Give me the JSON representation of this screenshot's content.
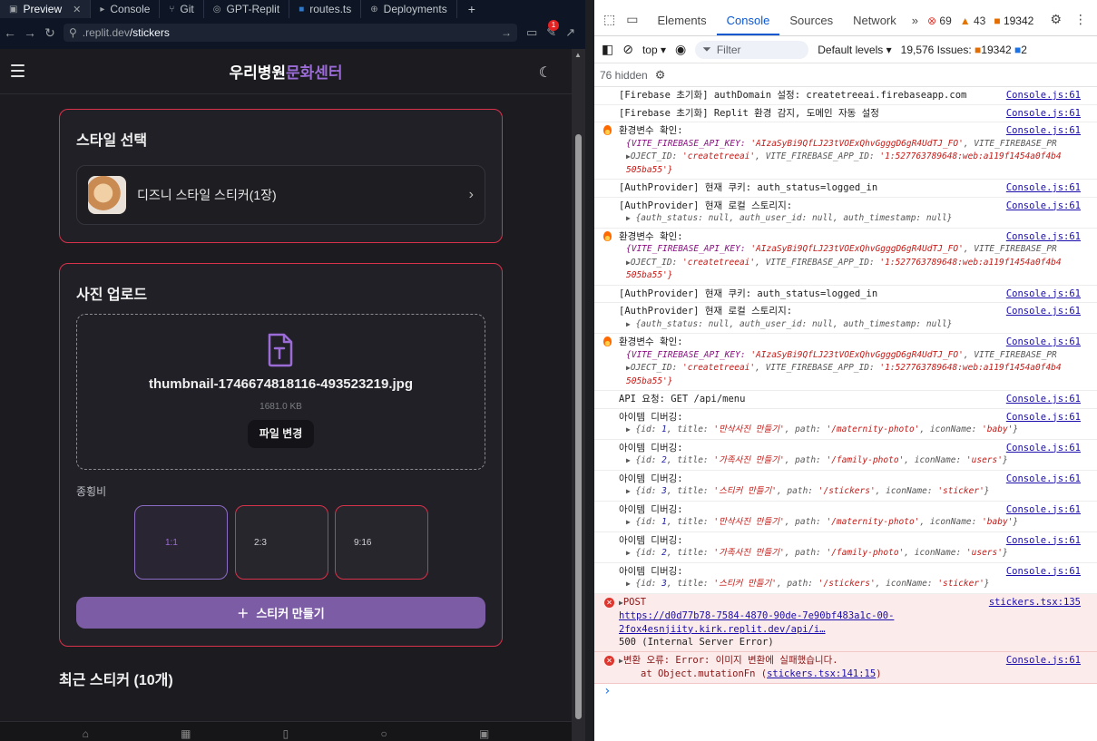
{
  "browser": {
    "tabs": [
      {
        "label": "Preview",
        "icon": "preview-icon"
      },
      {
        "label": "Console",
        "icon": "console-icon"
      },
      {
        "label": "Git",
        "icon": "git-icon"
      },
      {
        "label": "GPT-Replit",
        "icon": "gpt-icon"
      },
      {
        "label": "routes.ts",
        "icon": "ts-file-icon"
      },
      {
        "label": "Deployments",
        "icon": "deployments-icon"
      }
    ],
    "url_dim": ".replit.dev",
    "url_path": "/stickers",
    "notification_count": "1"
  },
  "app": {
    "brand_main": "우리병원",
    "brand_accent": "문화센터",
    "style_card_title": "스타일 선택",
    "style_option": "디즈니 스타일 스티커(1장)",
    "upload_card_title": "사진 업로드",
    "file_name": "thumbnail-1746674818116-493523219.jpg",
    "file_size": "1681.0 KB",
    "change_file": "파일 변경",
    "ratio_label": "종횡비",
    "ratios": [
      "1:1",
      "2:3",
      "9:16"
    ],
    "make_button": "스티커 만들기",
    "recent_title": "최근 스티커 (10개)",
    "colors": {
      "accent": "#9b6bd6",
      "card_border": "#d8324b",
      "button": "#7d5ca6"
    }
  },
  "devtools": {
    "tabs": [
      "Elements",
      "Console",
      "Sources",
      "Network"
    ],
    "errors": "69",
    "warnings": "43",
    "issues_badge": "19342",
    "context": "top",
    "filter_placeholder": "Filter",
    "levels": "Default levels",
    "issues_total": "19,576 Issues:",
    "issues_count": "19342",
    "issues_extra": "2",
    "hidden": "76 hidden",
    "messages": [
      {
        "type": "log",
        "text": "[Firebase 초기화] authDomain 설정: createtreeai.firebaseapp.com",
        "src": "Console.js:61"
      },
      {
        "type": "log",
        "text": "[Firebase 초기화] Replit 환경 감지, 도메인 자동 설정",
        "src": "Console.js:61"
      },
      {
        "type": "env",
        "text": "환경변수 확인:",
        "src": "Console.js:61"
      },
      {
        "type": "log",
        "text": "[AuthProvider] 현재 쿠키: auth_status=logged_in",
        "src": "Console.js:61"
      },
      {
        "type": "storage",
        "text": "[AuthProvider] 현재 로컬 스토리지:",
        "src": "Console.js:61"
      },
      {
        "type": "env",
        "text": "환경변수 확인:",
        "src": "Console.js:61"
      },
      {
        "type": "log",
        "text": "[AuthProvider] 현재 쿠키: auth_status=logged_in",
        "src": "Console.js:61"
      },
      {
        "type": "storage",
        "text": "[AuthProvider] 현재 로컬 스토리지:",
        "src": "Console.js:61"
      },
      {
        "type": "env",
        "text": "환경변수 확인:",
        "src": "Console.js:61"
      },
      {
        "type": "log",
        "text": "API 요청: GET /api/menu",
        "src": "Console.js:61"
      },
      {
        "type": "item",
        "text": "아이템 디버깅:",
        "src": "Console.js:61",
        "id": "1",
        "title": "'만삭사진 만들기'",
        "path": "'/maternity-photo'",
        "icon": "'baby'"
      },
      {
        "type": "item",
        "text": "아이템 디버깅:",
        "src": "Console.js:61",
        "id": "2",
        "title": "'가족사진 만들기'",
        "path": "'/family-photo'",
        "icon": "'users'"
      },
      {
        "type": "item",
        "text": "아이템 디버깅:",
        "src": "Console.js:61",
        "id": "3",
        "title": "'스티커 만들기'",
        "path": "'/stickers'",
        "icon": "'sticker'"
      },
      {
        "type": "item",
        "text": "아이템 디버깅:",
        "src": "Console.js:61",
        "id": "1",
        "title": "'만삭사진 만들기'",
        "path": "'/maternity-photo'",
        "icon": "'baby'"
      },
      {
        "type": "item",
        "text": "아이템 디버깅:",
        "src": "Console.js:61",
        "id": "2",
        "title": "'가족사진 만들기'",
        "path": "'/family-photo'",
        "icon": "'users'"
      },
      {
        "type": "item",
        "text": "아이템 디버깅:",
        "src": "Console.js:61",
        "id": "3",
        "title": "'스티커 만들기'",
        "path": "'/stickers'",
        "icon": "'sticker'"
      }
    ],
    "env_line1_key": "VITE_FIREBASE_API_KEY:",
    "env_line1_val": "'AIzaSyBi9QfLJ23tVOExQhvGgggD6gR4UdTJ_FO'",
    "env_line1_tail": ", VITE_FIREBASE_PR",
    "env_line2_a": "OJECT_ID:",
    "env_line2_b": "'createtreeai'",
    "env_line2_c": ", VITE_FIREBASE_APP_ID:",
    "env_line2_d": "'1:527763789648:web:a119f1454a0f4b4",
    "env_line3": "505ba55'}",
    "storage_obj": "{auth_status: null, auth_user_id: null, auth_timestamp: null}",
    "error1": {
      "method": "POST",
      "url": "https://d0d77b78-7584-4870-90de-7e90bf483a1c-00-2fox4esnjiity.kirk.replit.dev/api/i…",
      "status": "500 (Internal Server Error)",
      "src": "stickers.tsx:135"
    },
    "error2": {
      "text": "변환 오류: Error: 이미지 변환에 실패했습니다.",
      "at": "at Object.mutationFn (",
      "at_link": "stickers.tsx:141:15",
      "at_end": ")",
      "src": "Console.js:61"
    }
  }
}
